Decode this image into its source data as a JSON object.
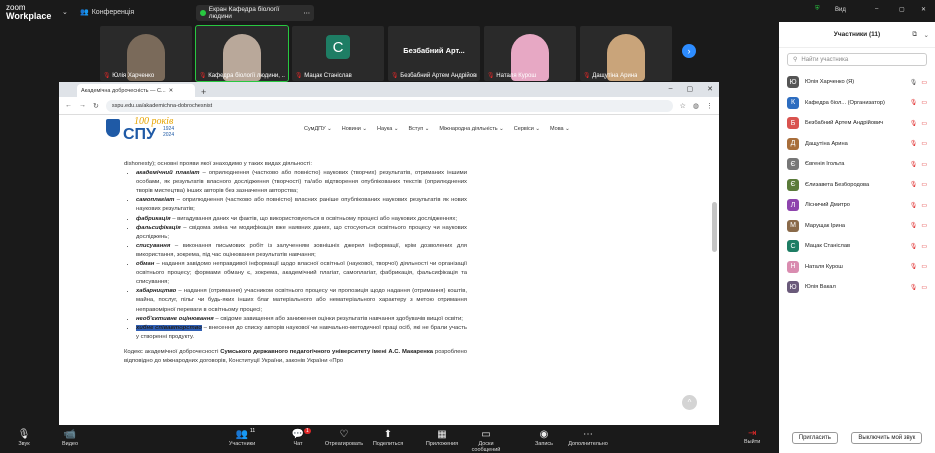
{
  "app": {
    "logo_line1": "zoom",
    "logo_line2": "Workplace",
    "conference": "Конференція",
    "share_label": "Екран Кафедра біології людини"
  },
  "tiles": [
    {
      "name": "Юлія Харченко",
      "type": "video",
      "color": "#7a6a5a"
    },
    {
      "name": "Кафедра біології людини, ...",
      "type": "video",
      "color": "#b9a89a"
    },
    {
      "name": "Мацак Станіслав",
      "type": "avatar",
      "letter": "C"
    },
    {
      "name": "Безбабний Артем Андрійович",
      "type": "text",
      "title": "Безбабний  Арт..."
    },
    {
      "name": "Наталя Курош",
      "type": "video",
      "color": "#e7a8c4"
    },
    {
      "name": "Дащутіна Арина",
      "type": "video",
      "color": "#c9a47a"
    }
  ],
  "browser": {
    "tab_title": "Академічна доброчесність — С...",
    "url": "sspu.edu.ua/akademichna-dobrochesnist",
    "nav": [
      "СумДПУ",
      "Новини",
      "Наука",
      "Вступ",
      "Міжнародна діяльність",
      "Сервіси",
      "Мова"
    ],
    "logo": {
      "l1": "100 років",
      "l2": "СПУ",
      "l3": "1924\n2024"
    },
    "intro": "dishonesty); основні прояви якої знаходимо у таких видах діяльності:",
    "items": [
      {
        "term": "академічний плагіат",
        "text": " – оприлюднення (частково або повністю) наукових (творчих) результатів, отриманих іншими особами, як результатів власного дослідження (творчості) та/або відтворення опублікованих текстів (оприлюднених творів мистецтва) інших авторів без зазначення авторства;"
      },
      {
        "term": "самоплагіат",
        "text": " – оприлюднення (частково або повністю) власних раніше опублікованих наукових результатів як нових наукових результатів;"
      },
      {
        "term": "фабрикація",
        "text": " – вигадування даних чи фактів, що використовуються в освітньому процесі або наукових дослідженнях;"
      },
      {
        "term": "фальсифікація",
        "text": " – свідома зміна чи модифікація вже наявних даних, що стосуються освітнього процесу чи наукових досліджень;"
      },
      {
        "term": "списування",
        "text": " – виконання письмових робіт із залученням зовнішніх джерел інформації, крім дозволених для використання, зокрема, під час оцінювання результатів навчання;"
      },
      {
        "term": "обман",
        "text": " – надання завідомо неправдивої інформації щодо власної освітньої (наукової, творчої) діяльності чи організації освітнього процесу; формами обману є, зокрема, академічний плагіат, самоплагіат, фабрикація, фальсифікація та списування;"
      },
      {
        "term": "хабарництво",
        "text": " – надання (отримання) учасником освітнього процесу чи пропозиція щодо надання (отримання) коштів, майна, послуг, пільг чи будь-яких інших благ матеріального або нематеріального характеру з метою отримання неправомірної переваги в освітньому процесі;"
      },
      {
        "term": "необ'єктивне оцінювання",
        "text": " – свідоме завищення або заниження оцінки результатів навчання здобувачів вищої освіти;"
      },
      {
        "term": "хибне співавторство",
        "text": " – внесення до списку авторів наукової чи навчально-методичної праці осіб, які не брали участь у створенні продукту."
      }
    ],
    "footer_a": "Кодекс академічної доброчесності ",
    "footer_b": "Сумського державного педагогічного університету імені А.С. Макаренка",
    "footer_c": " розроблено відповідно до міжнародних договорів, Конституції України, законів України «Про"
  },
  "toolbar": [
    {
      "label": "Звук",
      "icon": "🎙"
    },
    {
      "label": "Видео",
      "icon": "📹"
    },
    {
      "label": "Участники",
      "icon": "👥",
      "badge": "11"
    },
    {
      "label": "Чат",
      "icon": "💬",
      "badge": "1"
    },
    {
      "label": "Отреагировать",
      "icon": "♡"
    },
    {
      "label": "Поделиться",
      "icon": "⬆"
    },
    {
      "label": "Приложения",
      "icon": "▦"
    },
    {
      "label": "Доски сообщений",
      "icon": "▭"
    },
    {
      "label": "Запись",
      "icon": "◉"
    },
    {
      "label": "Дополнительно",
      "icon": "⋯"
    }
  ],
  "leave": "Выйти",
  "panel": {
    "view": "Вид",
    "title": "Участники (11)",
    "search_placeholder": "Найти участника",
    "people": [
      {
        "name": "Юлія Харченко (Я)",
        "letter": "Ю",
        "color": "#555"
      },
      {
        "name": "Кафедра біол... (Организатор)",
        "letter": "К",
        "color": "#2d6dc0"
      },
      {
        "name": "Безбабний Артем Андрійович",
        "letter": "Б",
        "color": "#d9534f"
      },
      {
        "name": "Дащутіна Арина",
        "letter": "Д",
        "color": "#a86e3a"
      },
      {
        "name": "Євгенія Ігольта",
        "letter": "Є",
        "color": "#777"
      },
      {
        "name": "Єлизавета Безбородова",
        "letter": "Є",
        "color": "#5a7b3a"
      },
      {
        "name": "Лісничий Дмитро",
        "letter": "Л",
        "color": "#8e44ad"
      },
      {
        "name": "Марущак Ірина",
        "letter": "М",
        "color": "#8a6a4a"
      },
      {
        "name": "Мацак Станіслав",
        "letter": "С",
        "color": "#1e7d64"
      },
      {
        "name": "Наталя Курош",
        "letter": "Н",
        "color": "#d98cb0"
      },
      {
        "name": "Юлія Вакал",
        "letter": "Ю",
        "color": "#6a5a7a"
      }
    ],
    "invite": "Пригласить",
    "mute_all": "Выключить мой звук"
  }
}
